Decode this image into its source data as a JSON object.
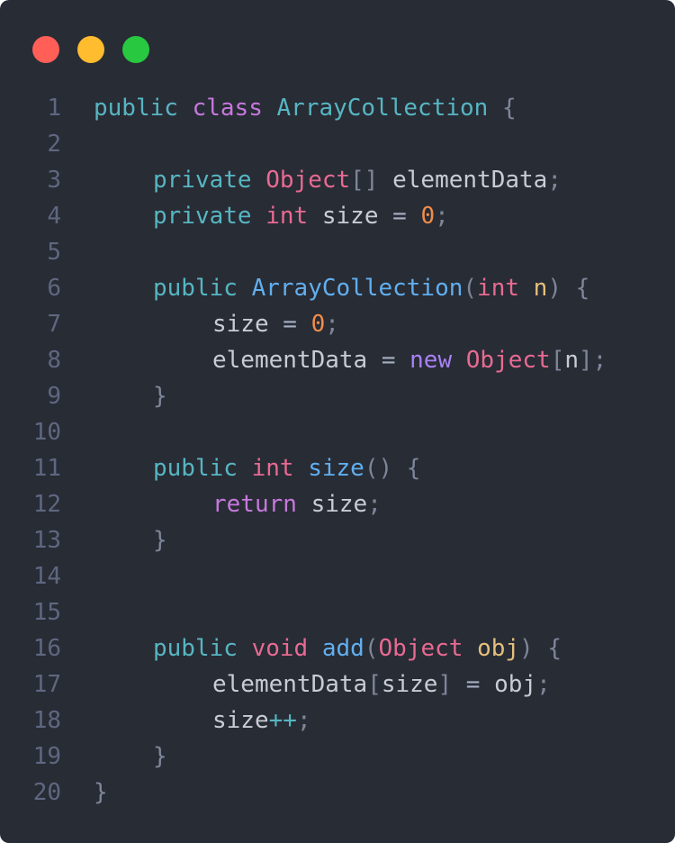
{
  "window": {
    "traffic_lights": [
      {
        "name": "close",
        "color": "#ff5f57"
      },
      {
        "name": "minimize",
        "color": "#febc2e"
      },
      {
        "name": "maximize",
        "color": "#28c840"
      }
    ]
  },
  "code": {
    "language": "java",
    "lines": [
      {
        "num": "1",
        "indent": 0,
        "tokens": [
          {
            "t": "public",
            "k": "kw"
          },
          {
            "t": " ",
            "k": "plain"
          },
          {
            "t": "class",
            "k": "cls"
          },
          {
            "t": " ",
            "k": "plain"
          },
          {
            "t": "ArrayCollection",
            "k": "name"
          },
          {
            "t": " ",
            "k": "plain"
          },
          {
            "t": "{",
            "k": "punc"
          }
        ]
      },
      {
        "num": "2",
        "indent": 0,
        "tokens": []
      },
      {
        "num": "3",
        "indent": 1,
        "tokens": [
          {
            "t": "private",
            "k": "kw"
          },
          {
            "t": " ",
            "k": "plain"
          },
          {
            "t": "Object",
            "k": "type"
          },
          {
            "t": "[]",
            "k": "punc"
          },
          {
            "t": " elementData",
            "k": "plain"
          },
          {
            "t": ";",
            "k": "punc"
          }
        ]
      },
      {
        "num": "4",
        "indent": 1,
        "tokens": [
          {
            "t": "private",
            "k": "kw"
          },
          {
            "t": " ",
            "k": "plain"
          },
          {
            "t": "int",
            "k": "type"
          },
          {
            "t": " size ",
            "k": "plain"
          },
          {
            "t": "=",
            "k": "op"
          },
          {
            "t": " ",
            "k": "plain"
          },
          {
            "t": "0",
            "k": "num"
          },
          {
            "t": ";",
            "k": "punc"
          }
        ]
      },
      {
        "num": "5",
        "indent": 0,
        "tokens": []
      },
      {
        "num": "6",
        "indent": 1,
        "tokens": [
          {
            "t": "public",
            "k": "kw"
          },
          {
            "t": " ",
            "k": "plain"
          },
          {
            "t": "ArrayCollection",
            "k": "fn"
          },
          {
            "t": "(",
            "k": "punc"
          },
          {
            "t": "int",
            "k": "type"
          },
          {
            "t": " ",
            "k": "plain"
          },
          {
            "t": "n",
            "k": "param"
          },
          {
            "t": ")",
            "k": "punc"
          },
          {
            "t": " ",
            "k": "plain"
          },
          {
            "t": "{",
            "k": "punc"
          }
        ]
      },
      {
        "num": "7",
        "indent": 2,
        "tokens": [
          {
            "t": "size ",
            "k": "plain"
          },
          {
            "t": "=",
            "k": "op"
          },
          {
            "t": " ",
            "k": "plain"
          },
          {
            "t": "0",
            "k": "num"
          },
          {
            "t": ";",
            "k": "punc"
          }
        ]
      },
      {
        "num": "8",
        "indent": 2,
        "tokens": [
          {
            "t": "elementData ",
            "k": "plain"
          },
          {
            "t": "=",
            "k": "op"
          },
          {
            "t": " ",
            "k": "plain"
          },
          {
            "t": "new",
            "k": "new"
          },
          {
            "t": " ",
            "k": "plain"
          },
          {
            "t": "Object",
            "k": "type"
          },
          {
            "t": "[",
            "k": "punc"
          },
          {
            "t": "n",
            "k": "plain"
          },
          {
            "t": "]",
            "k": "punc"
          },
          {
            "t": ";",
            "k": "punc"
          }
        ]
      },
      {
        "num": "9",
        "indent": 1,
        "tokens": [
          {
            "t": "}",
            "k": "punc"
          }
        ]
      },
      {
        "num": "10",
        "indent": 0,
        "tokens": []
      },
      {
        "num": "11",
        "indent": 1,
        "tokens": [
          {
            "t": "public",
            "k": "kw"
          },
          {
            "t": " ",
            "k": "plain"
          },
          {
            "t": "int",
            "k": "type"
          },
          {
            "t": " ",
            "k": "plain"
          },
          {
            "t": "size",
            "k": "fn"
          },
          {
            "t": "()",
            "k": "punc"
          },
          {
            "t": " ",
            "k": "plain"
          },
          {
            "t": "{",
            "k": "punc"
          }
        ]
      },
      {
        "num": "12",
        "indent": 2,
        "tokens": [
          {
            "t": "return",
            "k": "ret"
          },
          {
            "t": " size",
            "k": "plain"
          },
          {
            "t": ";",
            "k": "punc"
          }
        ]
      },
      {
        "num": "13",
        "indent": 1,
        "tokens": [
          {
            "t": "}",
            "k": "punc"
          }
        ]
      },
      {
        "num": "14",
        "indent": 0,
        "tokens": []
      },
      {
        "num": "15",
        "indent": 0,
        "tokens": []
      },
      {
        "num": "16",
        "indent": 1,
        "tokens": [
          {
            "t": "public",
            "k": "kw"
          },
          {
            "t": " ",
            "k": "plain"
          },
          {
            "t": "void",
            "k": "type"
          },
          {
            "t": " ",
            "k": "plain"
          },
          {
            "t": "add",
            "k": "fn"
          },
          {
            "t": "(",
            "k": "punc"
          },
          {
            "t": "Object",
            "k": "type"
          },
          {
            "t": " ",
            "k": "plain"
          },
          {
            "t": "obj",
            "k": "param"
          },
          {
            "t": ")",
            "k": "punc"
          },
          {
            "t": " ",
            "k": "plain"
          },
          {
            "t": "{",
            "k": "punc"
          }
        ]
      },
      {
        "num": "17",
        "indent": 2,
        "tokens": [
          {
            "t": "elementData",
            "k": "plain"
          },
          {
            "t": "[",
            "k": "punc"
          },
          {
            "t": "size",
            "k": "plain"
          },
          {
            "t": "]",
            "k": "punc"
          },
          {
            "t": " ",
            "k": "plain"
          },
          {
            "t": "=",
            "k": "op"
          },
          {
            "t": " obj",
            "k": "plain"
          },
          {
            "t": ";",
            "k": "punc"
          }
        ]
      },
      {
        "num": "18",
        "indent": 2,
        "tokens": [
          {
            "t": "size",
            "k": "plain"
          },
          {
            "t": "++",
            "k": "inc"
          },
          {
            "t": ";",
            "k": "punc"
          }
        ]
      },
      {
        "num": "19",
        "indent": 1,
        "tokens": [
          {
            "t": "}",
            "k": "punc"
          }
        ]
      },
      {
        "num": "20",
        "indent": 0,
        "tokens": [
          {
            "t": "}",
            "k": "punc"
          }
        ]
      }
    ]
  }
}
